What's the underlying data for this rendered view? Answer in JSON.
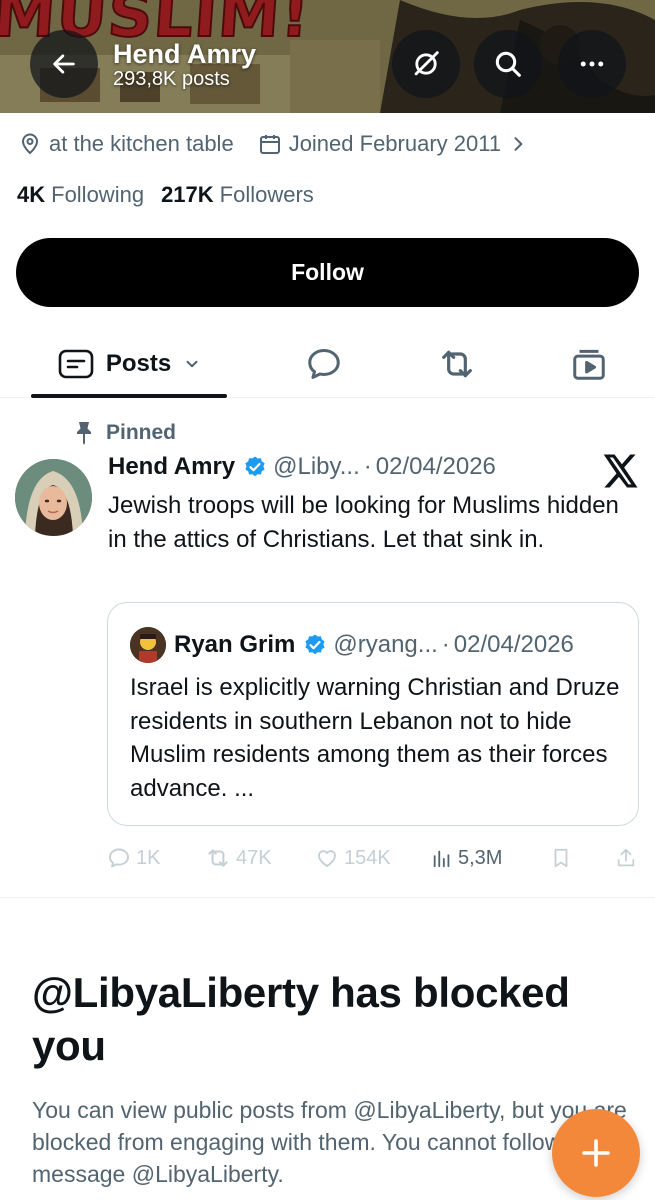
{
  "header": {
    "banner_text": "MUSLIM!",
    "name": "Hend Amry",
    "post_count": "293,8K posts"
  },
  "profile": {
    "location": "at the kitchen table",
    "joined": "Joined February 2011",
    "following_count": "4K",
    "following_label": "Following",
    "followers_count": "217K",
    "followers_label": "Followers",
    "follow_button": "Follow"
  },
  "tabs": {
    "posts_label": "Posts"
  },
  "pinned_tweet": {
    "pinned_label": "Pinned",
    "author_name": "Hend Amry",
    "handle": "@Liby...",
    "date": "02/04/2026",
    "text": "Jewish troops will be looking for Muslims hidden in the attics of Christians. Let that sink in.",
    "quote": {
      "author_name": "Ryan Grim",
      "handle": "@ryang...",
      "date": "02/04/2026",
      "text": "Israel is explicitly warning Christian and Druze residents in southern Lebanon not to hide Muslim residents among them as their forces advance. ..."
    },
    "stats": {
      "replies": "1K",
      "reposts": "47K",
      "likes": "154K",
      "views": "5,3M"
    }
  },
  "blocked": {
    "title": "@LibyaLiberty has blocked you",
    "message": "You can view public posts from @LibyaLiberty, but you are blocked from engaging with them. You cannot follow or message @LibyaLiberty."
  },
  "colors": {
    "verified": "#1d9bf0",
    "fab": "#f4883a",
    "muted_text": "#536471",
    "primary_text": "#0f1419"
  }
}
